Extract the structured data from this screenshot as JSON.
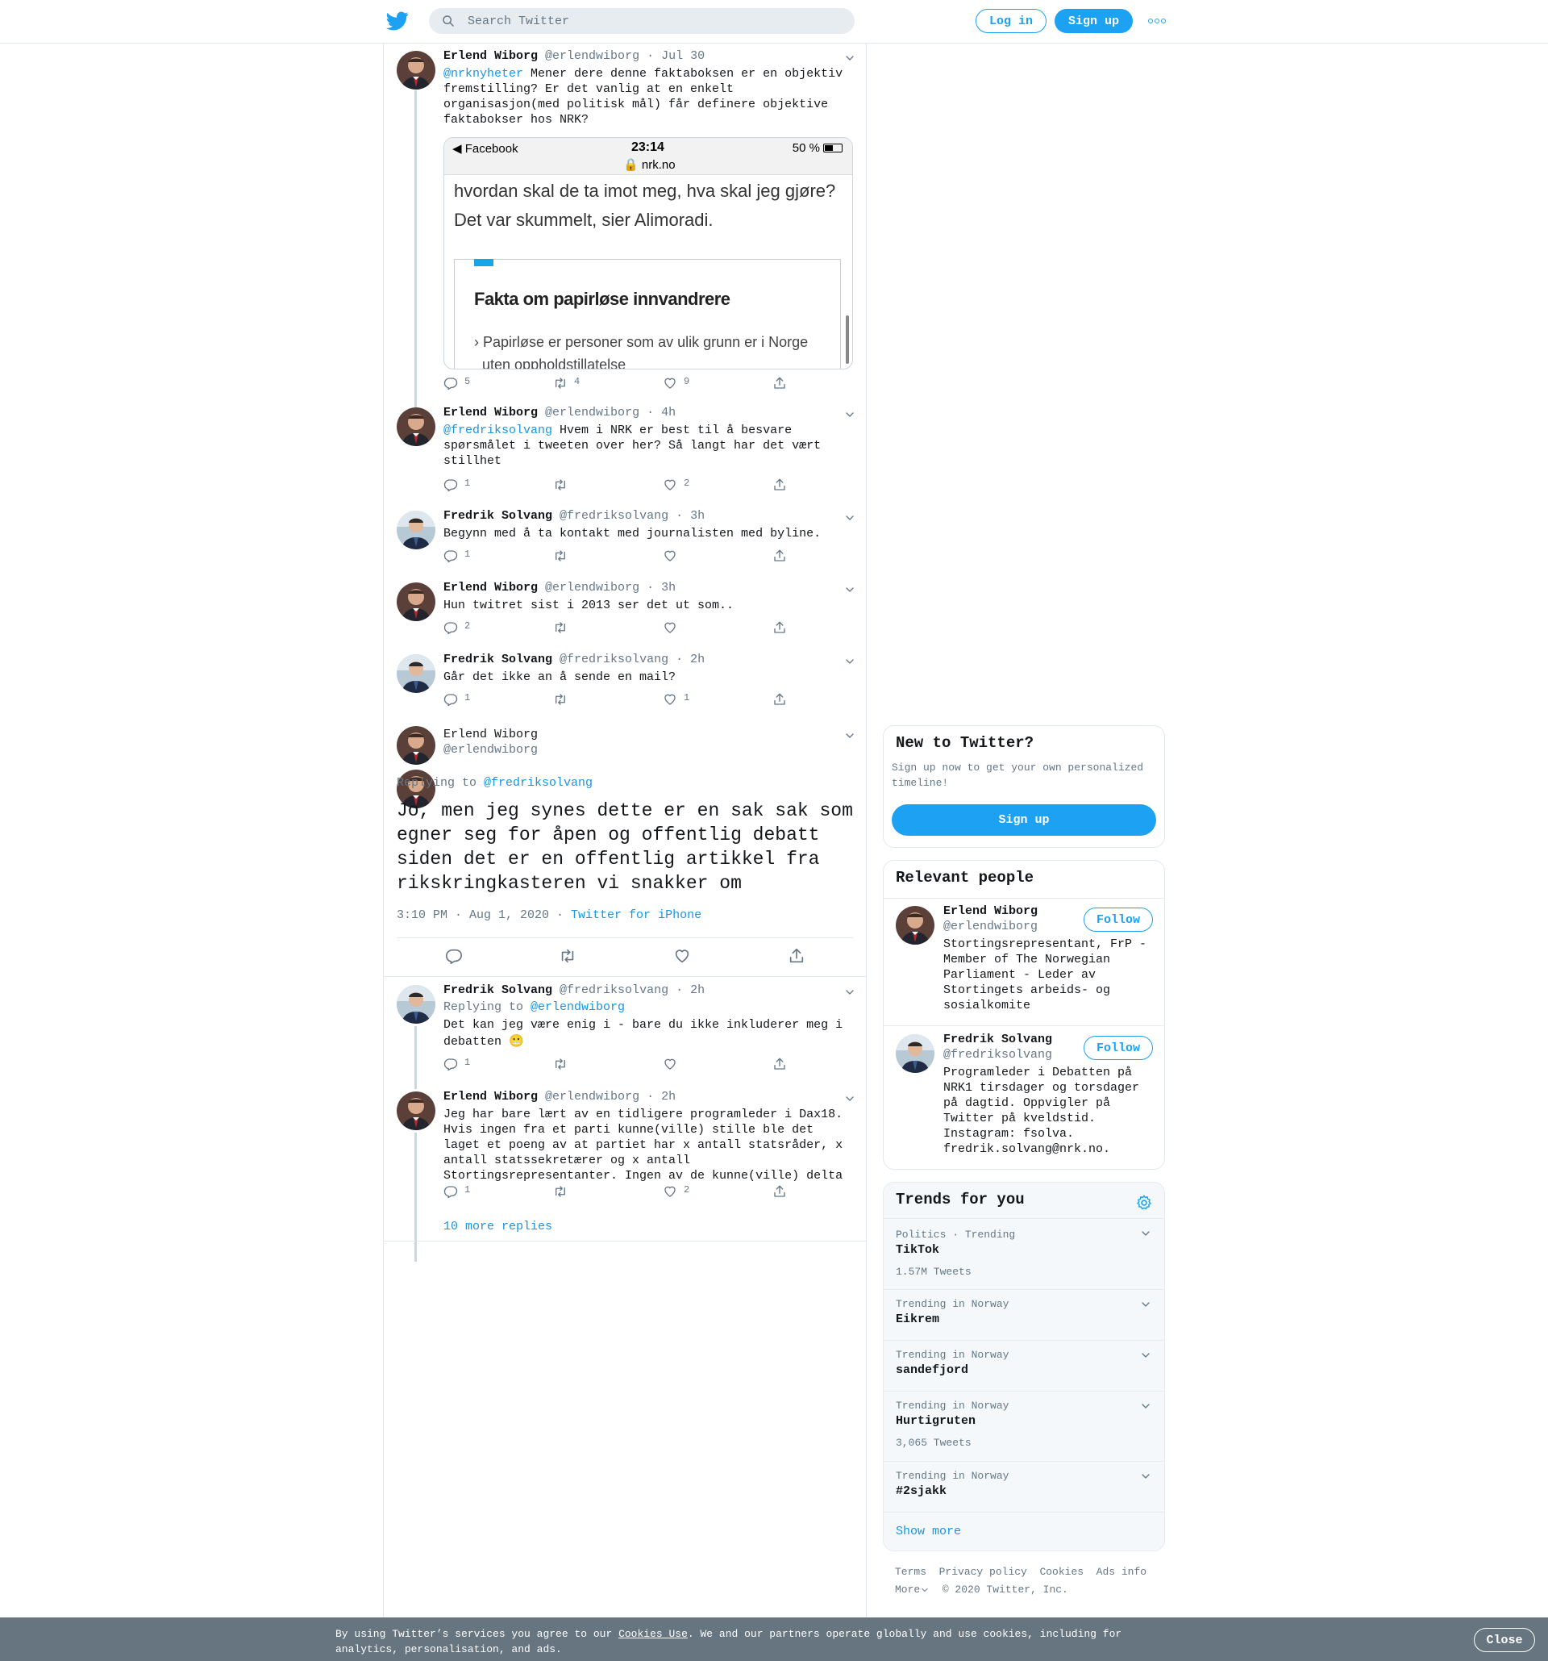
{
  "topbar": {
    "search_placeholder": "Search Twitter",
    "login_label": "Log in",
    "signup_label": "Sign up"
  },
  "tweets": [
    {
      "name": "Erlend Wiborg",
      "handle": "@erlendwiborg",
      "time": "Jul 30",
      "mention": "@nrknyheter",
      "text": " Mener dere denne faktaboksen er en objektiv fremstilling? Er det vanlig at en enkelt organisasjon(med politisk mål) får definere objektive faktabokser hos NRK?",
      "replies": "5",
      "retweets": "4",
      "likes": "9"
    },
    {
      "name": "Erlend Wiborg",
      "handle": "@erlendwiborg",
      "time": "4h",
      "mention": "@fredriksolvang",
      "text": " Hvem i NRK er best til å besvare spørsmålet i tweeten over her? Så langt har det vært stillhet",
      "replies": "1",
      "retweets": "",
      "likes": "2"
    },
    {
      "name": "Fredrik Solvang",
      "handle": "@fredriksolvang",
      "time": "3h",
      "text": "Begynn med å ta kontakt med journalisten med byline.",
      "replies": "1",
      "retweets": "",
      "likes": ""
    },
    {
      "name": "Erlend Wiborg",
      "handle": "@erlendwiborg",
      "time": "3h",
      "text": "Hun twitret sist i 2013 ser det ut som..",
      "replies": "2",
      "retweets": "",
      "likes": ""
    },
    {
      "name": "Fredrik Solvang",
      "handle": "@fredriksolvang",
      "time": "2h",
      "text": "Går det ikke an å sende en mail?",
      "replies": "1",
      "retweets": "",
      "likes": "1"
    }
  ],
  "embed": {
    "carrier": "◀ Facebook",
    "time": "23:14",
    "battery": "50 %",
    "url": "nrk.no",
    "para_1": "hvordan skal de ta imot meg, hva skal jeg gjøre?",
    "para_2": "Det var skummelt, sier Alimoradi.",
    "fact_title": "Fakta om papirløse innvandrere",
    "fact_item_1": "Papirløse er personer som av ulik grunn er i Norge",
    "fact_item_2": "uten oppholdstillatelse"
  },
  "focus": {
    "name": "Erlend Wiborg",
    "handle": "@erlendwiborg",
    "replying_prefix": "Replying to ",
    "replying_to": "@fredriksolvang",
    "text": "Jo, men jeg synes dette er en sak sak som egner seg for åpen og offentlig debatt siden det er en offentlig artikkel fra rikskringkasteren vi snakker om",
    "timestamp": "3:10 PM · Aug 1, 2020",
    "dot": " · ",
    "source": "Twitter for iPhone"
  },
  "replies_after": [
    {
      "name": "Fredrik Solvang",
      "handle": "@fredriksolvang",
      "time": "2h",
      "replying_prefix": "Replying to ",
      "replying_to": "@erlendwiborg",
      "text": "Det kan jeg være enig i - bare du ikke inkluderer meg i debatten 😬",
      "replies": "1",
      "retweets": "",
      "likes": ""
    },
    {
      "name": "Erlend Wiborg",
      "handle": "@erlendwiborg",
      "time": "2h",
      "text": "Jeg har bare lært av en tidligere programleder i Dax18. Hvis ingen fra et parti kunne(ville) stille ble det laget et poeng av at partiet har x antall statsråder, x antall statssekretærer og x antall Stortingsrepresentanter. Ingen av de kunne(ville) delta",
      "replies": "1",
      "retweets": "",
      "likes": "2"
    }
  ],
  "more_replies": "10 more replies",
  "new_to_twitter": {
    "title": "New to Twitter?",
    "text": "Sign up now to get your own personalized timeline!",
    "button": "Sign up"
  },
  "relevant_people": {
    "title": "Relevant people",
    "people": [
      {
        "name": "Erlend Wiborg",
        "handle": "@erlendwiborg",
        "bio": "Stortingsrepresentant, FrP - Member of The Norwegian Parliament - Leder av Stortingets arbeids- og sosialkomite",
        "follow": "Follow"
      },
      {
        "name": "Fredrik Solvang",
        "handle": "@fredriksolvang",
        "bio": "Programleder i Debatten på NRK1 tirsdager og torsdager på dagtid. Oppvigler på Twitter på kveldstid. Instagram: fsolva. fredrik.solvang@nrk.no.",
        "follow": "Follow"
      }
    ]
  },
  "trends": {
    "title": "Trends for you",
    "items": [
      {
        "meta": "Politics · Trending",
        "name": "TikTok",
        "count": "1.57M Tweets"
      },
      {
        "meta": "Trending in Norway",
        "name": "Eikrem",
        "count": ""
      },
      {
        "meta": "Trending in Norway",
        "name": "sandefjord",
        "count": ""
      },
      {
        "meta": "Trending in Norway",
        "name": "Hurtigruten",
        "count": "3,065 Tweets"
      },
      {
        "meta": "Trending in Norway",
        "name": "#2sjakk",
        "count": ""
      }
    ],
    "show_more": "Show more"
  },
  "footer": {
    "terms": "Terms",
    "privacy": "Privacy policy",
    "cookies": "Cookies",
    "ads": "Ads info",
    "more": "More",
    "copyright": "© 2020 Twitter, Inc."
  },
  "cookie_banner": {
    "text_before": "By using Twitter’s services you agree to our ",
    "link": "Cookies Use",
    "text_after": ". We and our partners operate globally and use cookies, including for analytics, personalisation, and ads.",
    "close": "Close"
  },
  "colors": {
    "accent": "#1da1f2",
    "link": "#1b95e0",
    "text": "#14171a",
    "muted": "#657786",
    "border": "#e1e8ed",
    "banner": "#66757f"
  },
  "icons": [
    "twitter-bird-icon",
    "search-icon",
    "more-icon",
    "caret-down-icon",
    "reply-icon",
    "retweet-icon",
    "like-icon",
    "share-icon",
    "settings-icon"
  ]
}
